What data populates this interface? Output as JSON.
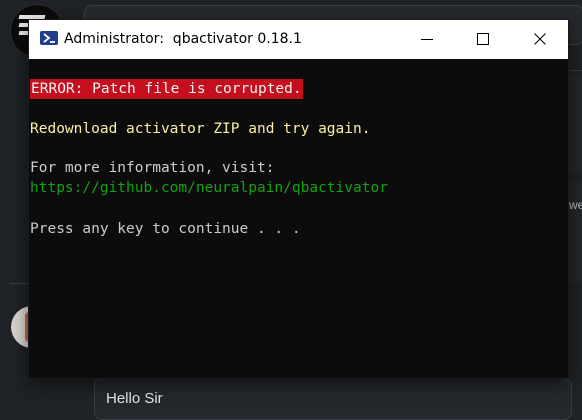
{
  "background": {
    "header_text": "",
    "partial_side_text": "we",
    "message_text": "Hello Sir"
  },
  "window": {
    "title": "Administrator:  qbactivator 0.18.1",
    "icon": "powershell-icon",
    "controls": [
      "minimize-icon",
      "maximize-icon",
      "close-icon"
    ]
  },
  "console": {
    "error_line": "ERROR: Patch file is corrupted.",
    "redownload_line": "Redownload activator ZIP and try again.",
    "more_info_line": "For more information, visit:",
    "url_line": "https://github.com/neuralpain/qbactivator",
    "press_key_line": "Press any key to continue . . ."
  },
  "colors": {
    "error_bg": "#c50f1f",
    "warning_text": "#f9f1a5",
    "link_text": "#13a10e",
    "console_bg": "#0c0c0c",
    "console_text": "#cccccc"
  }
}
